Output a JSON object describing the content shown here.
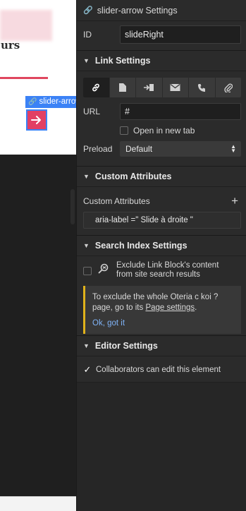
{
  "canvas": {
    "heading_fragment": "urs",
    "selection_label": "slider-arrow",
    "arrow_icon": "arrow-right-icon"
  },
  "panel": {
    "title": "slider-arrow Settings",
    "id_label": "ID",
    "id_value": "slideRight",
    "link_settings": {
      "heading": "Link Settings",
      "types": [
        {
          "name": "url",
          "icon": "link-icon",
          "active": true
        },
        {
          "name": "page",
          "icon": "page-icon",
          "active": false
        },
        {
          "name": "section",
          "icon": "section-anchor-icon",
          "active": false
        },
        {
          "name": "email",
          "icon": "envelope-icon",
          "active": false
        },
        {
          "name": "phone",
          "icon": "phone-icon",
          "active": false
        },
        {
          "name": "file",
          "icon": "paperclip-icon",
          "active": false
        }
      ],
      "url_label": "URL",
      "url_value": "#",
      "new_tab_label": "Open in new tab",
      "preload_label": "Preload",
      "preload_value": "Default"
    },
    "custom_attributes": {
      "heading": "Custom Attributes",
      "sub_label": "Custom Attributes",
      "items": [
        {
          "text": "aria-label =\" Slide à droite \""
        }
      ]
    },
    "search_index": {
      "heading": "Search Index Settings",
      "exclude_label": "Exclude Link Block's content from site search results",
      "info_text_before": "To exclude the whole Oteria c koi ? page, go to its ",
      "info_link": "Page settings",
      "info_text_after": ".",
      "ok_text": "Ok, got it"
    },
    "editor_settings": {
      "heading": "Editor Settings",
      "collab_label": "Collaborators can edit this element"
    }
  },
  "colors": {
    "accent_blue": "#3b82f6",
    "arrow_button": "#e23f64",
    "panel_bg": "#2b2b2b",
    "warning_border": "#e0b21b",
    "link_blue": "#7fb2f5"
  }
}
